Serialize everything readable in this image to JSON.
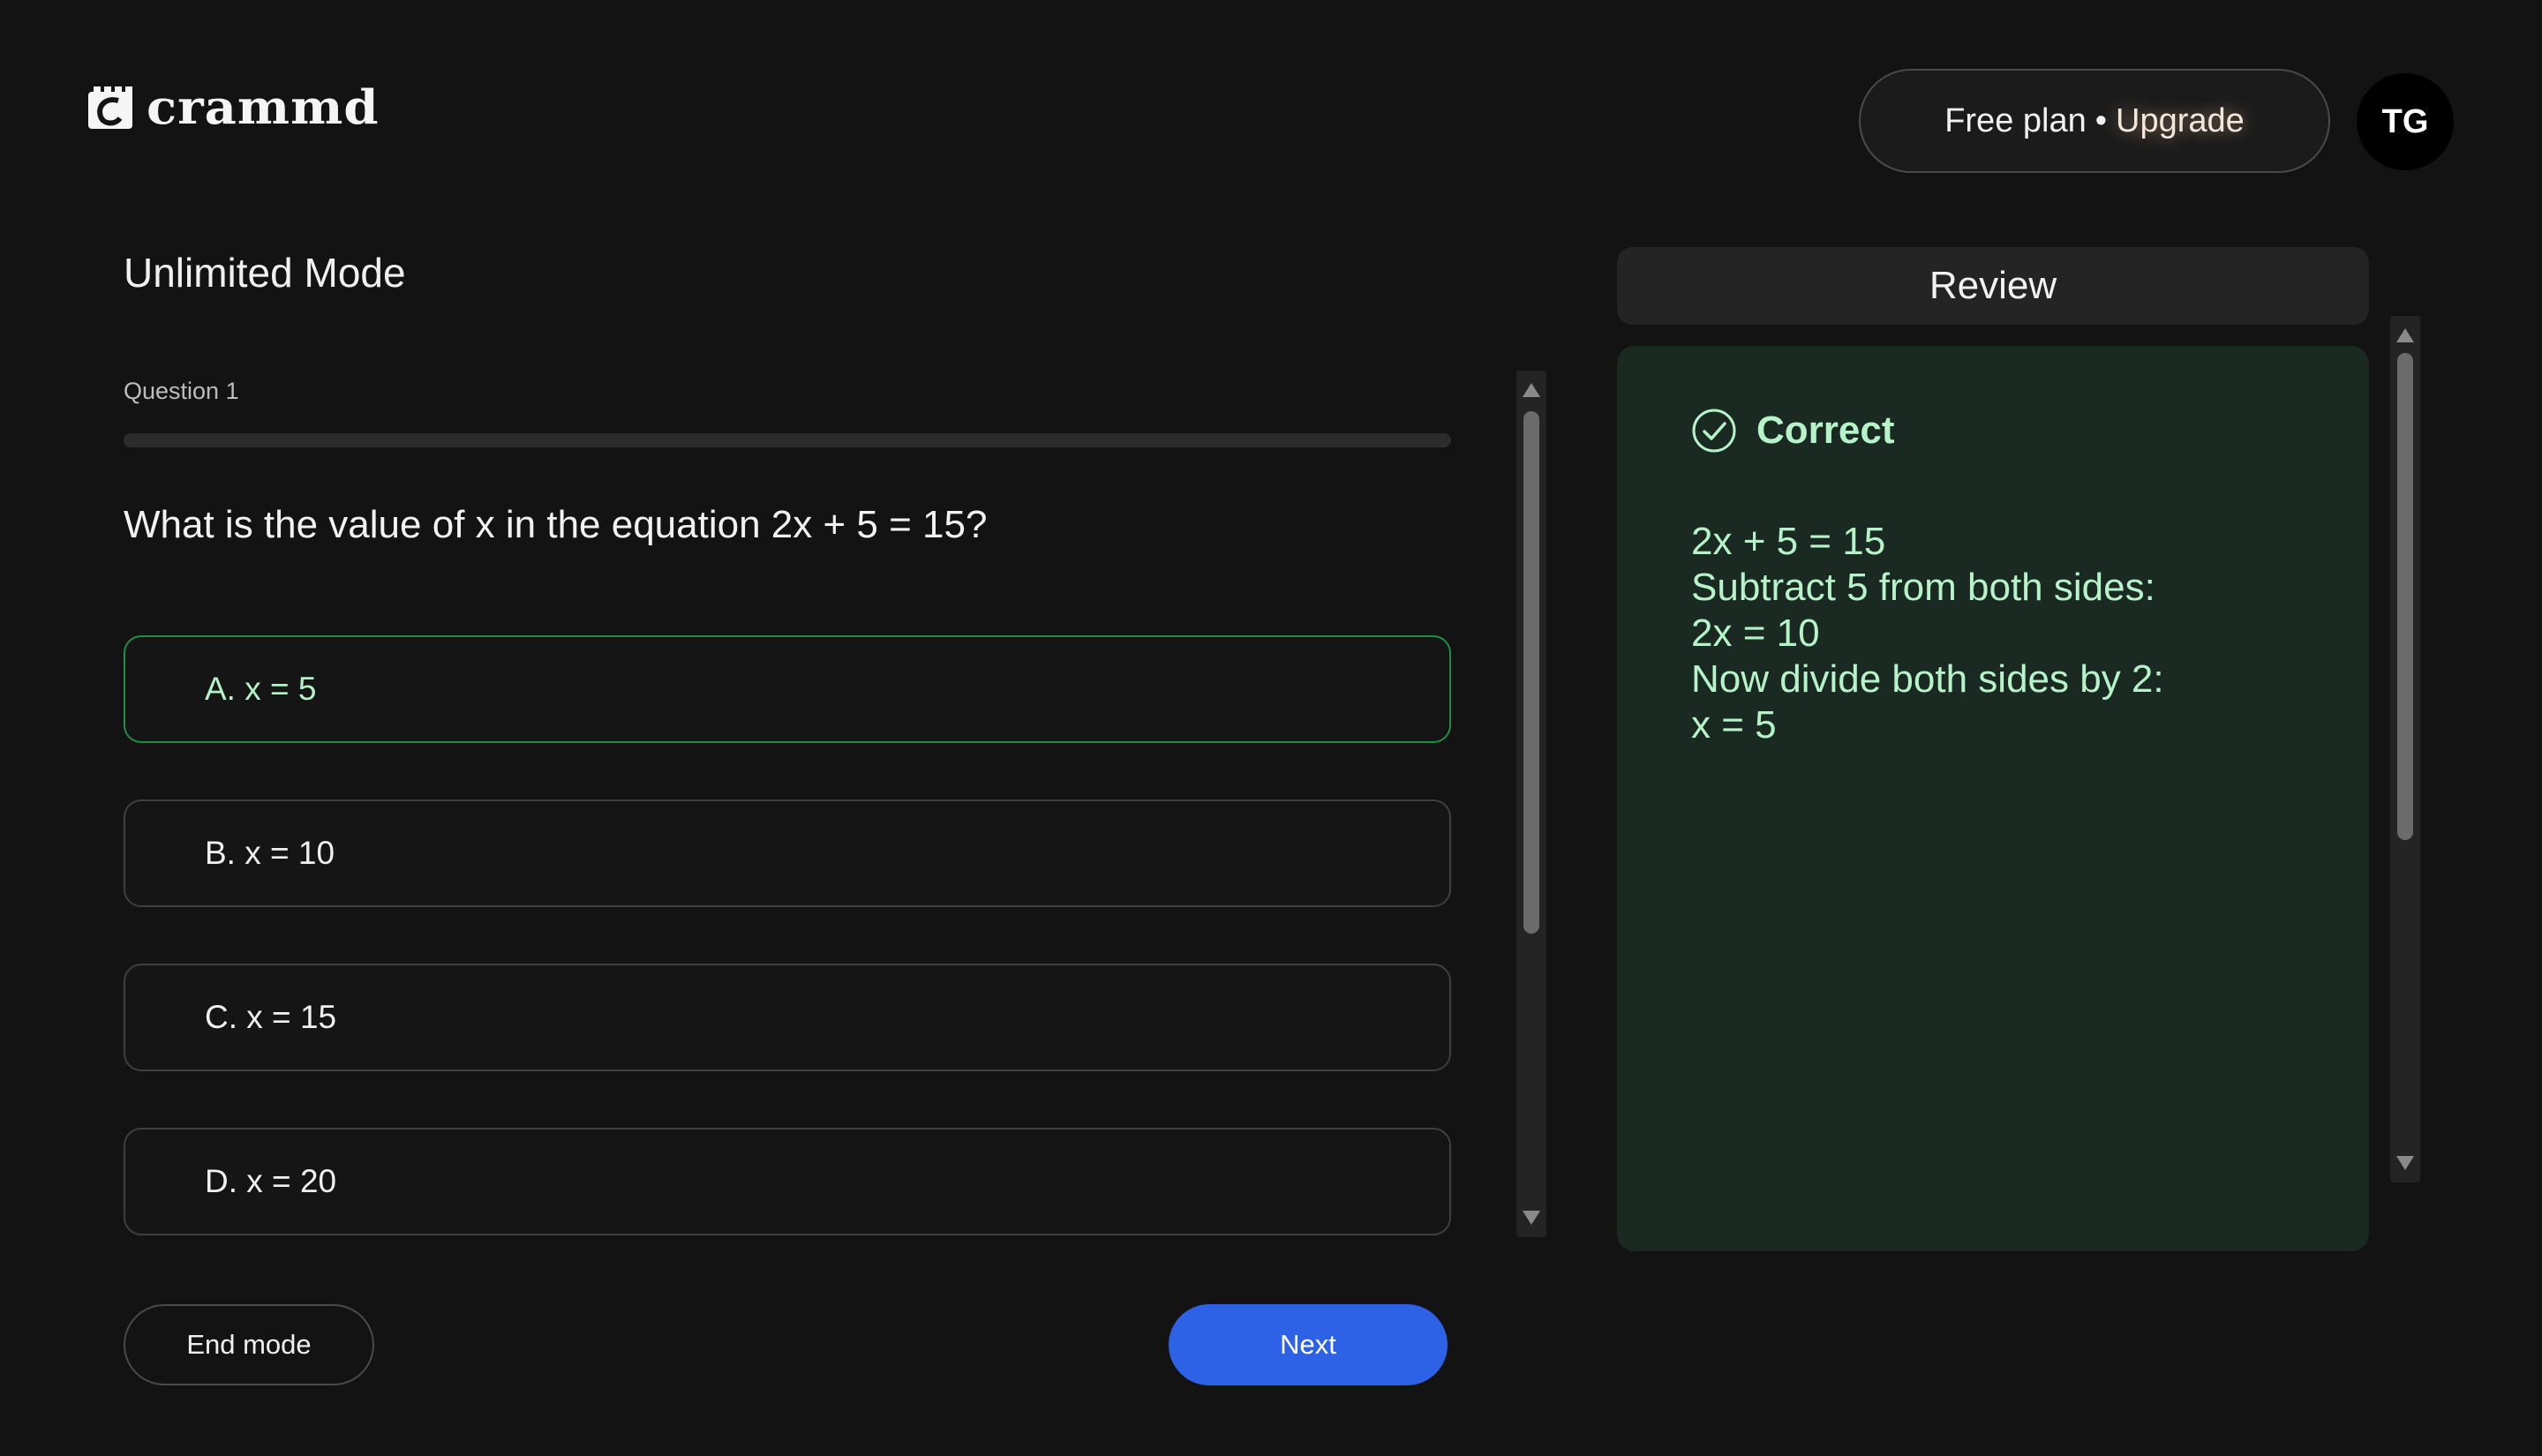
{
  "header": {
    "logo_text": "crammd",
    "plan_label": "Free plan",
    "plan_separator": "•",
    "upgrade_label": "Upgrade",
    "avatar_initials": "TG"
  },
  "quiz": {
    "mode_title": "Unlimited Mode",
    "question_label": "Question 1",
    "question_text": "What is the value of x in the equation 2x + 5 = 15?",
    "options": [
      {
        "label": "A. x = 5",
        "status": "correct"
      },
      {
        "label": "B. x = 10",
        "status": "neutral"
      },
      {
        "label": "C. x = 15",
        "status": "neutral"
      },
      {
        "label": "D. x = 20",
        "status": "neutral"
      }
    ],
    "end_button_label": "End mode",
    "next_button_label": "Next"
  },
  "review": {
    "header": "Review",
    "status_label": "Correct",
    "explanation_lines": [
      "2x + 5 = 15",
      "Subtract 5 from both sides:",
      "2x = 10",
      "Now divide both sides by 2:",
      "x = 5"
    ]
  },
  "colors": {
    "background": "#131313",
    "accent_blue": "#2d62e6",
    "correct_green_border": "#1f8f47",
    "correct_text": "#b6f3c8",
    "review_card_bg": "#1a2a22"
  }
}
